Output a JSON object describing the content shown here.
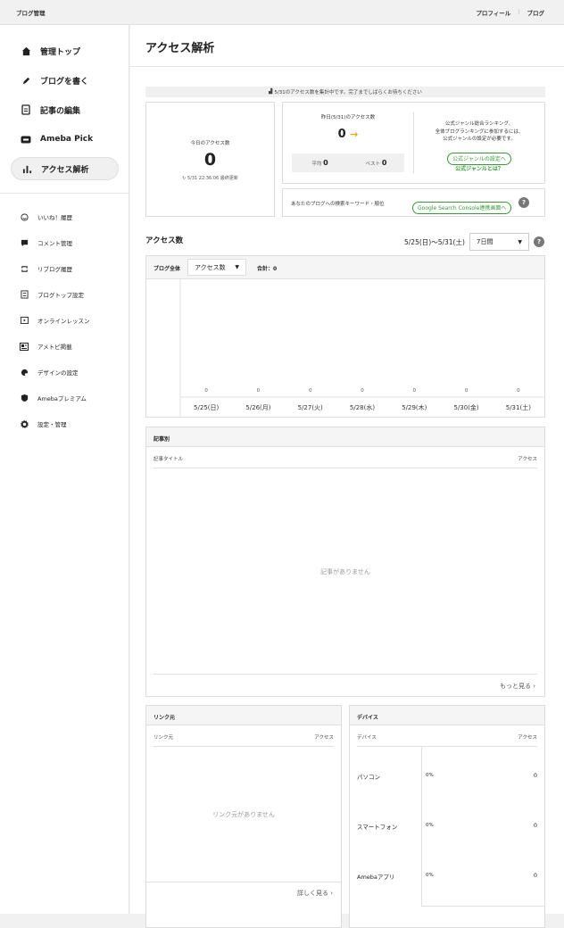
{
  "topbar": {
    "title": "ブログ管理",
    "links": [
      "プロフィール",
      "ブログ"
    ]
  },
  "sidebar": {
    "main": [
      {
        "label": "管理トップ",
        "icon": "home-icon"
      },
      {
        "label": "ブログを書く",
        "icon": "pen-icon"
      },
      {
        "label": "記事の編集",
        "icon": "document-icon"
      },
      {
        "label": "Ameba Pick",
        "icon": "pick-icon"
      },
      {
        "label": "アクセス解析",
        "icon": "bar-chart-icon"
      }
    ],
    "sub": [
      {
        "label": "いいね！履歴",
        "icon": "smile-icon"
      },
      {
        "label": "コメント管理",
        "icon": "comment-icon"
      },
      {
        "label": "リブログ履歴",
        "icon": "reblog-icon"
      },
      {
        "label": "ブログトップ設定",
        "icon": "top-settings-icon"
      },
      {
        "label": "オンラインレッスン",
        "icon": "lesson-icon"
      },
      {
        "label": "アメトピ掲載",
        "icon": "newspaper-icon"
      },
      {
        "label": "デザインの設定",
        "icon": "palette-icon"
      },
      {
        "label": "Amebaプレミアム",
        "icon": "shield-icon"
      },
      {
        "label": "設定・管理",
        "icon": "gear-icon"
      }
    ]
  },
  "main": {
    "title": "アクセス解析",
    "notice": "5/31のアクセス数を集計中です。完了までしばらくお待ちください",
    "today": {
      "label": "今日のアクセス数",
      "value": "0",
      "updated": "5/31 22:36:06 最終更新"
    },
    "yesterday": {
      "label": "昨日(5/31)のアクセス数",
      "value": "0",
      "avg_label": "平均",
      "avg": "0",
      "best_label": "ベスト",
      "best": "0"
    },
    "ranking": {
      "text1": "公式ジャンル総合ランキング、",
      "text2": "全体ブログランキングに参加するには、",
      "text3": "公式ジャンルの設定が必要です。",
      "button": "公式ジャンルの設定へ",
      "link": "公式ジャンルとは？"
    },
    "search": {
      "text": "あなたのブログへの検索キーワード・順位",
      "button": "Google Search Console連携画面へ"
    },
    "access": {
      "title": "アクセス数",
      "range": "5/25(日)〜5/31(土)",
      "period": "7日間",
      "scope": "ブログ全体",
      "metric": "アクセス数",
      "total": "合計：0"
    },
    "records": {
      "title": "記事別",
      "col1": "記事タイトル",
      "col2": "アクセス",
      "empty": "記事がありません",
      "more": "もっと見る"
    },
    "links": {
      "title": "リンク元",
      "col1": "リンク元",
      "col2": "アクセス",
      "empty": "リンク元がありません",
      "more": "詳しく見る"
    },
    "devices": {
      "title": "デバイス",
      "col1": "デバイス",
      "col2": "アクセス",
      "rows": [
        {
          "name": "パソコン",
          "pct": "0%",
          "count": "0"
        },
        {
          "name": "スマートフォン",
          "pct": "0%",
          "count": "0"
        },
        {
          "name": "Amebaアプリ",
          "pct": "0%",
          "count": "0"
        }
      ]
    }
  },
  "chart_data": {
    "type": "bar",
    "categories": [
      "5/25(日)",
      "5/26(月)",
      "5/27(火)",
      "5/28(水)",
      "5/29(木)",
      "5/30(金)",
      "5/31(土)"
    ],
    "values": [
      0,
      0,
      0,
      0,
      0,
      0,
      0
    ]
  }
}
